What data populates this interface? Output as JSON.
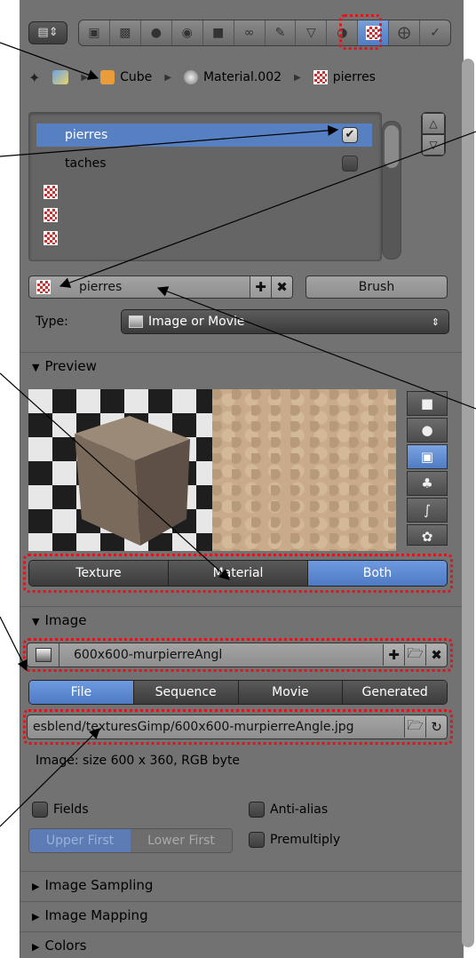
{
  "breadcrumb": {
    "object": "Cube",
    "material": "Material.002",
    "texture": "pierres"
  },
  "slots": {
    "items": [
      "pierres",
      "taches"
    ],
    "selected": "pierres"
  },
  "texture": {
    "name": "pierres",
    "brush_label": "Brush",
    "type_label": "Type:",
    "type_value": "Image or Movie"
  },
  "sections": {
    "preview": "Preview",
    "image": "Image",
    "image_sampling": "Image Sampling",
    "image_mapping": "Image Mapping",
    "colors": "Colors"
  },
  "preview_modes": {
    "items": [
      "Texture",
      "Material",
      "Both"
    ],
    "selected": "Both"
  },
  "image": {
    "name": "600x600-murpierreAngl",
    "source_tabs": [
      "File",
      "Sequence",
      "Movie",
      "Generated"
    ],
    "source_selected": "File",
    "filepath": "esblend/texturesGimp/600x600-murpierreAngle.jpg",
    "info": "Image: size 600 x 360, RGB byte"
  },
  "options": {
    "fields": "Fields",
    "anti_alias": "Anti-alias",
    "upper_first": "Upper First",
    "lower_first": "Lower First",
    "premultiply": "Premultiply"
  },
  "colors": {
    "panel": "#727272",
    "accent": "#5680c2",
    "highlight": "#e0141c"
  }
}
